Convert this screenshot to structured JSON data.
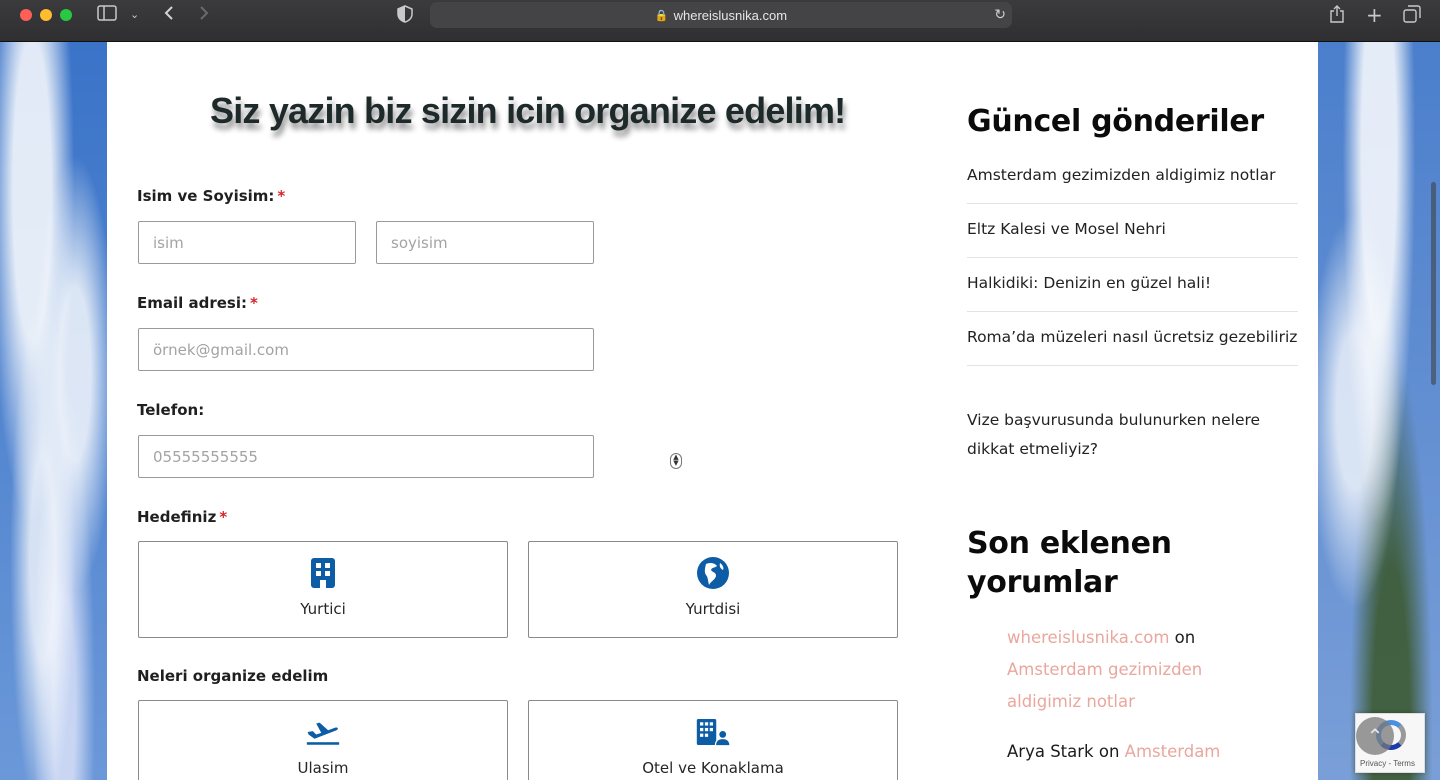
{
  "browser": {
    "url": "whereislusnika.com"
  },
  "form": {
    "title": "Siz yazin biz sizin icin organize edelim!",
    "name_label": "Isim ve Soyisim:",
    "first_name_placeholder": "isim",
    "last_name_placeholder": "soyisim",
    "email_label": "Email adresi:",
    "email_placeholder": "örnek@gmail.com",
    "phone_label": "Telefon:",
    "phone_placeholder": "05555555555",
    "required_mark": "*",
    "destination_label": "Hedefiniz",
    "destination_options": [
      {
        "label": "Yurtici",
        "icon": "building-icon"
      },
      {
        "label": "Yurtdisi",
        "icon": "globe-icon"
      }
    ],
    "organize_label": "Neleri organize edelim",
    "organize_options": [
      {
        "label": "Ulasim",
        "icon": "airplane-icon"
      },
      {
        "label": "Otel ve Konaklama",
        "icon": "hotel-guest-icon"
      }
    ],
    "accent_color": "#0c5da6"
  },
  "sidebar": {
    "recent_posts_title": "Güncel gönderiler",
    "recent_posts": [
      "Amsterdam gezimizden aldigimiz notlar",
      "Eltz Kalesi ve Mosel Nehri",
      "Halkidiki: Denizin en güzel hali!",
      "Roma’da müzeleri nasıl ücretsiz gezebiliriz",
      "Vize başvurusunda bulunurken nelere dikkat etmeliyiz?"
    ],
    "recent_comments_title": "Son eklenen yorumlar",
    "comments": [
      {
        "author": "whereislusnika.com",
        "on": "on",
        "post": "Amsterdam gezimizden aldigimiz notlar"
      },
      {
        "author": "Arya Stark",
        "on": "on",
        "post": "Amsterdam"
      }
    ],
    "link_color": "#e9a79d"
  },
  "recaptcha": {
    "text": "Privacy - Terms"
  }
}
